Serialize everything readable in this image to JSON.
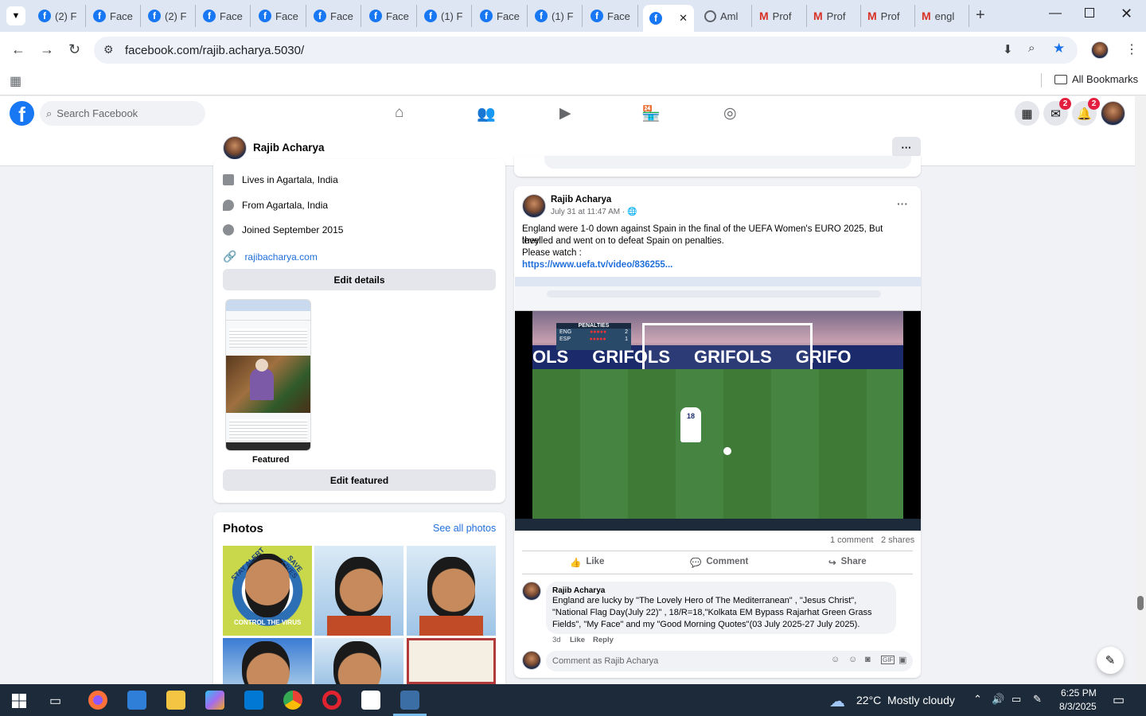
{
  "browser": {
    "tabs": [
      {
        "label": "(2) F",
        "icon": "facebook-icon"
      },
      {
        "label": "Face",
        "icon": "facebook-icon"
      },
      {
        "label": "(2) F",
        "icon": "facebook-icon"
      },
      {
        "label": "Face",
        "icon": "facebook-icon"
      },
      {
        "label": "Face",
        "icon": "facebook-icon"
      },
      {
        "label": "Face",
        "icon": "facebook-icon"
      },
      {
        "label": "Face",
        "icon": "facebook-icon"
      },
      {
        "label": "(1) F",
        "icon": "facebook-icon"
      },
      {
        "label": "Face",
        "icon": "facebook-icon"
      },
      {
        "label": "(1) F",
        "icon": "facebook-icon"
      },
      {
        "label": "Face",
        "icon": "facebook-icon"
      },
      {
        "label": "",
        "icon": "facebook-icon",
        "active": true
      },
      {
        "label": "Aml",
        "icon": "globe-icon"
      },
      {
        "label": "Prof",
        "icon": "gmail-icon"
      },
      {
        "label": "Prof",
        "icon": "gmail-icon"
      },
      {
        "label": "Prof",
        "icon": "gmail-icon"
      },
      {
        "label": "engl",
        "icon": "gmail-icon"
      }
    ],
    "url": "facebook.com/rajib.acharya.5030/",
    "bookmarks_label": "All Bookmarks"
  },
  "fb": {
    "logo": "f",
    "search_placeholder": "Search Facebook",
    "messenger_badge": "2",
    "notifications_badge": "2"
  },
  "profile": {
    "name": "Rajib Acharya"
  },
  "intro": {
    "lives_prefix": "Lives in ",
    "lives_place": "Agartala, India",
    "from_prefix": "From ",
    "from_place": "Agartala, India",
    "joined": "Joined September 2015",
    "website": "rajibacharya.com",
    "edit_details": "Edit details",
    "featured_label": "Featured",
    "edit_featured": "Edit featured"
  },
  "photos": {
    "title": "Photos",
    "see_all": "See all photos",
    "p1_text1": "STAY ALERT",
    "p1_text2": "SAVE LIVES",
    "p1_text3": "CONTROL THE VIRUS"
  },
  "post": {
    "author": "Rajib Acharya",
    "time": "July 31 at 11:47 AM · ",
    "line1": "England were 1-0 down against Spain in the final of the UEFA Women's EURO 2025, But they",
    "line2": "levelled and went on to defeat Spain on penalties.",
    "line3": "Please watch :",
    "link": "https://www.uefa.tv/video/836255...",
    "video_score_title": "PENALTIES",
    "video_team1": "ENG",
    "video_team2": "ESP",
    "video_score1": "2",
    "video_score2": "1",
    "video_ad": "GRIFOLS",
    "player_number": "18",
    "comments_count": "1 comment",
    "shares_count": "2 shares",
    "like": "Like",
    "comment": "Comment",
    "share": "Share"
  },
  "comment": {
    "author": "Rajib Acharya",
    "line1": "England are lucky by \"The Lovely Hero of The Mediterranean\" , \"Jesus Christ\",",
    "line2": "\"National Flag Day(July 22)\" , 18/R=18,\"Kolkata EM Bypass Rajarhat Green Grass",
    "line3": "Fields\", \"My Face\" and my \"Good Morning Quotes\"(03 July 2025-27 July 2025).",
    "age": "3d",
    "like": "Like",
    "reply": "Reply",
    "input_placeholder": "Comment as Rajib Acharya"
  },
  "taskbar": {
    "weather": "22°C  Mostly cloudy",
    "time": "6:25 PM",
    "date": "8/3/2025"
  },
  "colors": {
    "fb_blue": "#1877f2",
    "link": "#216fdb",
    "taskbar": "#1c2a3a",
    "pitch": "#3f7a36"
  }
}
